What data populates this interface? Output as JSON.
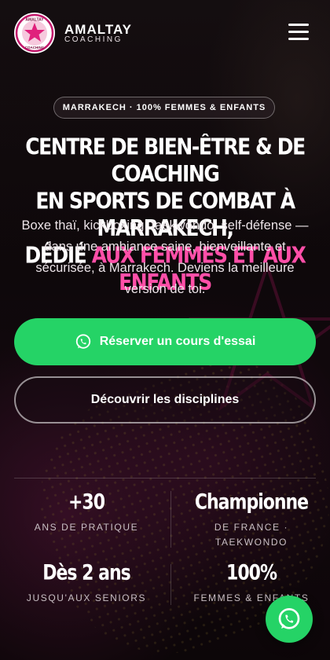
{
  "brand": {
    "logo_text_top": "AMALTAY",
    "logo_text_bottom": "COACHING",
    "name": "AMALTAY",
    "subtitle": "COACHING"
  },
  "header": {
    "menu_icon": "hamburger-menu-icon"
  },
  "hero": {
    "badge": "MARRAKECH · 100% FEMMES & ENFANTS",
    "title_line1": "CENTRE DE BIEN-ÊTRE & DE COACHING",
    "title_line2": "EN SPORTS DE COMBAT À MARRAKECH,",
    "title_line3_plain": "DÉDIÉ ",
    "title_line3_accent": "AUX FEMMES ET AUX ENFANTS",
    "intro": "Boxe thaï, kickboxing, taekwondo, self-défense — dans une ambiance saine, bienveillante et sécurisée, à Marrakech. Deviens la meilleure version de toi."
  },
  "cta": {
    "primary_label": "Réserver un cours d'essai",
    "primary_icon": "whatsapp-icon",
    "secondary_label": "Découvrir les disciplines"
  },
  "stats": [
    {
      "value": "+30",
      "label": "ANS DE PRATIQUE"
    },
    {
      "value": "Championne",
      "label": "DE FRANCE · TAEKWONDO"
    },
    {
      "value": "Dès 2 ans",
      "label": "JUSQU'AUX SENIORS"
    },
    {
      "value": "100%",
      "label": "FEMMES & ENFANTS"
    }
  ],
  "floating": {
    "icon": "whatsapp-icon"
  },
  "colors": {
    "accent_pink": "#ff4fa8",
    "whatsapp_green": "#25d366",
    "background": "#0d0709"
  }
}
